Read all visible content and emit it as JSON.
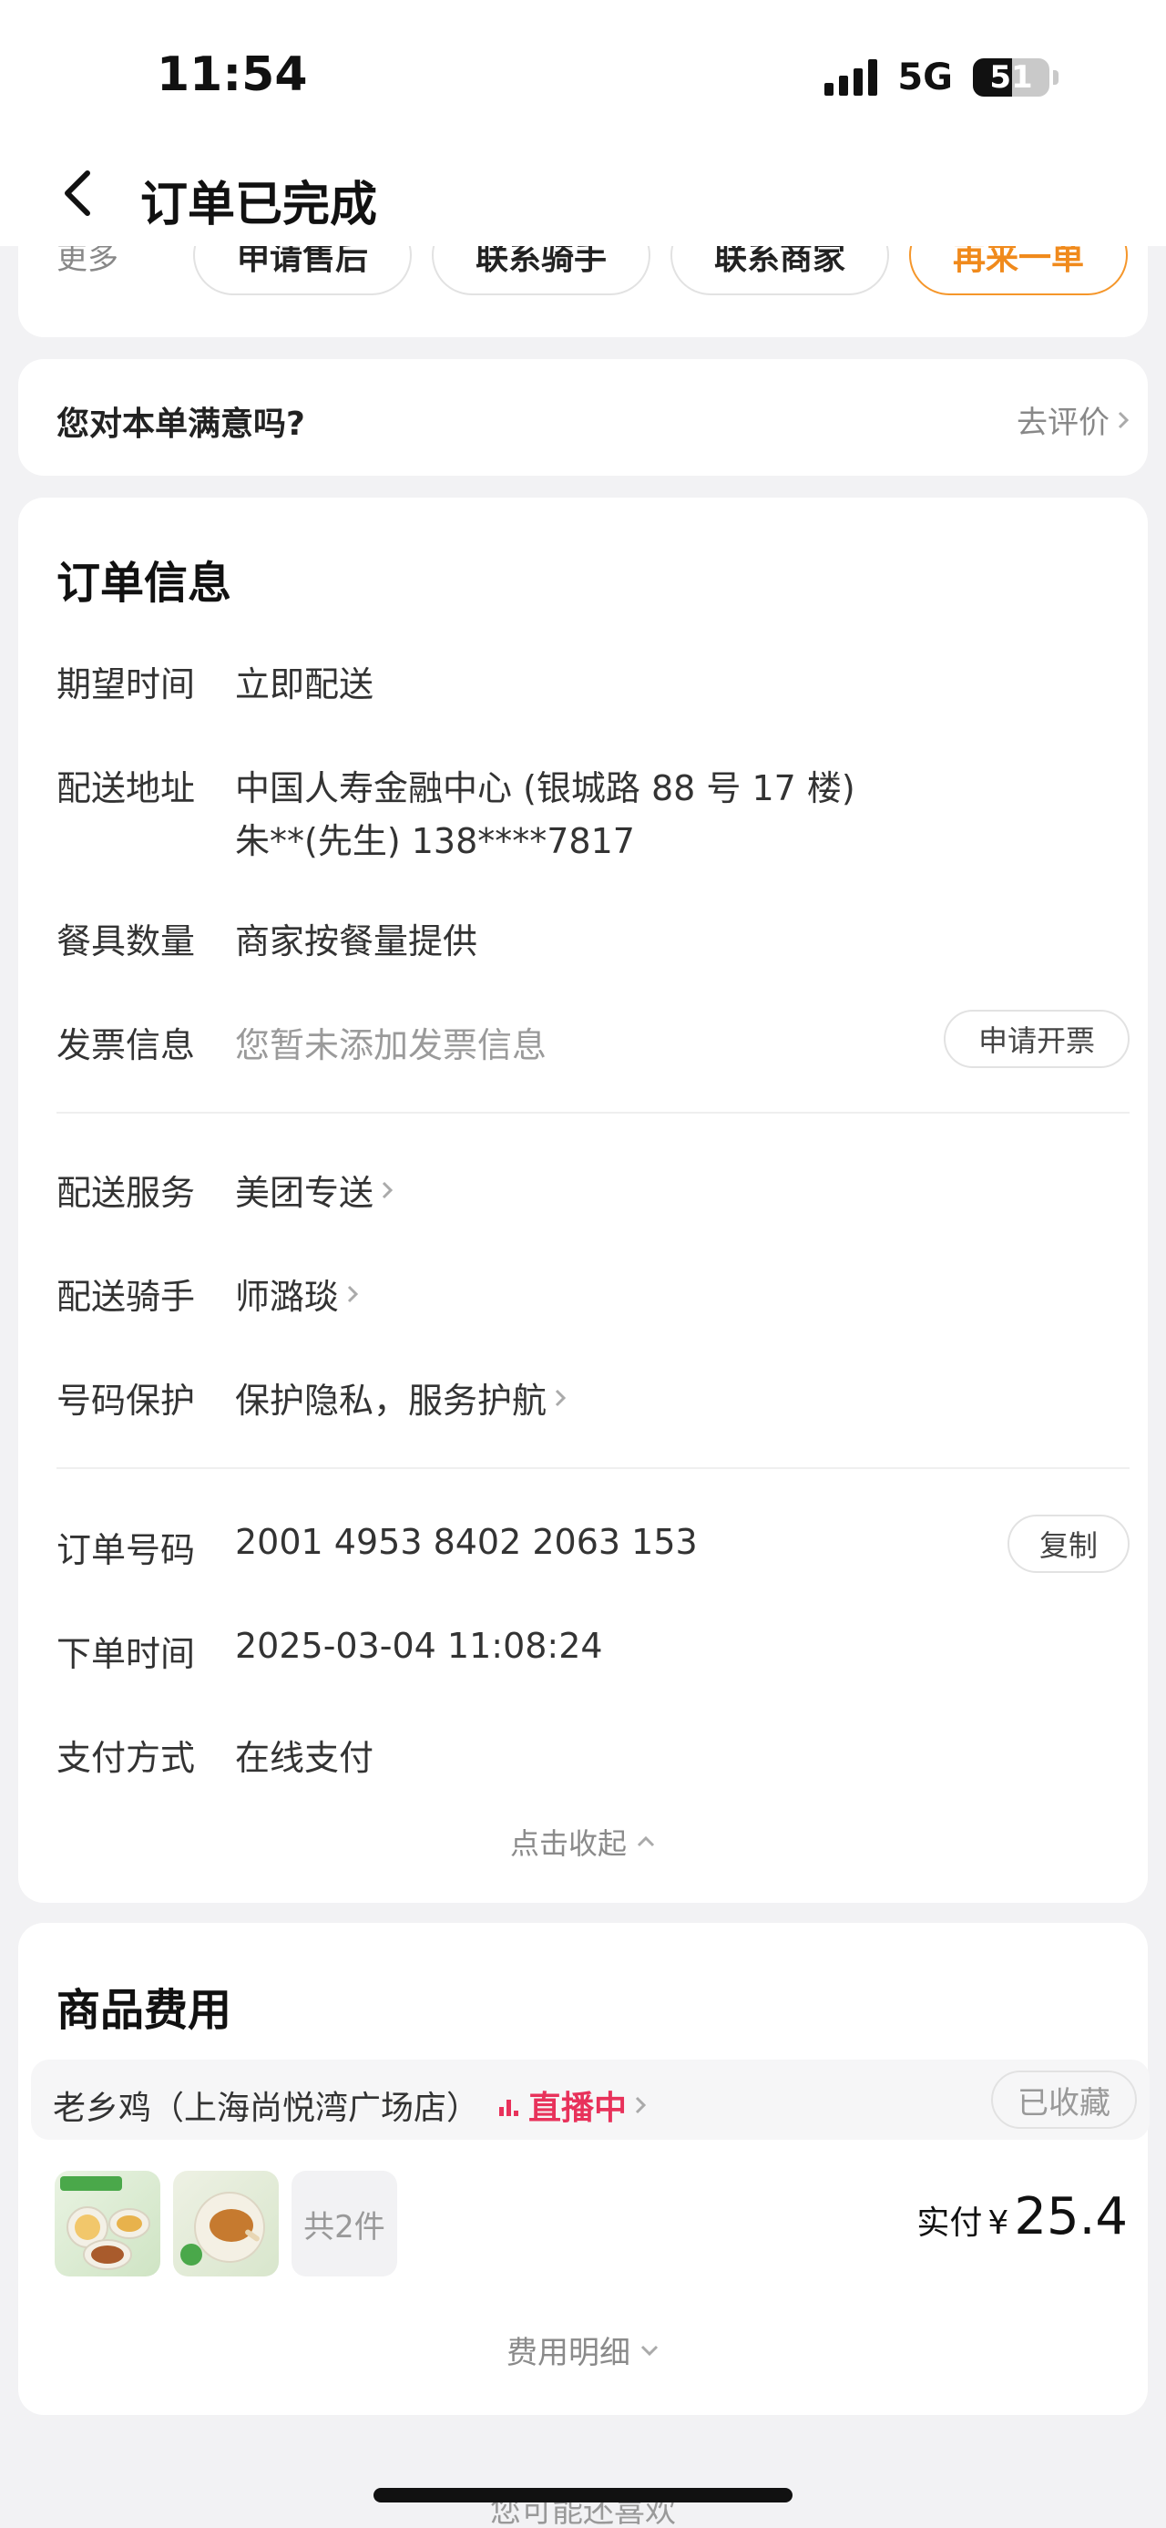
{
  "status_bar": {
    "time": "11:54",
    "network": "5G",
    "battery": "51"
  },
  "nav": {
    "title": "订单已完成"
  },
  "actions": {
    "more": "更多",
    "buttons": [
      "申请售后",
      "联系骑手",
      "联系商家",
      "再来一单"
    ]
  },
  "rating": {
    "question": "您对本单满意吗?",
    "link": "去评价"
  },
  "order_info": {
    "title": "订单信息",
    "expect_time": {
      "label": "期望时间",
      "value": "立即配送"
    },
    "address": {
      "label": "配送地址",
      "line1": "中国人寿金融中心 (银城路 88 号 17 楼)",
      "line2": "朱**(先生) 138****7817"
    },
    "tableware": {
      "label": "餐具数量",
      "value": "商家按餐量提供"
    },
    "invoice": {
      "label": "发票信息",
      "value": "您暂未添加发票信息",
      "button": "申请开票"
    },
    "delivery_service": {
      "label": "配送服务",
      "value": "美团专送"
    },
    "rider": {
      "label": "配送骑手",
      "value": "师潞琰"
    },
    "number_protect": {
      "label": "号码保护",
      "value": "保护隐私，服务护航"
    },
    "order_no": {
      "label": "订单号码",
      "value": "2001 4953 8402 2063 153",
      "button": "复制"
    },
    "order_time": {
      "label": "下单时间",
      "value": "2025-03-04 11:08:24"
    },
    "pay_method": {
      "label": "支付方式",
      "value": "在线支付"
    },
    "collapse": "点击收起"
  },
  "goods": {
    "title": "商品费用",
    "store": "老乡鸡（上海尚悦湾广场店）",
    "live": "直播中",
    "fav": "已收藏",
    "count": "共2件",
    "pay_label": "实付",
    "currency": "¥",
    "amount": "25.4",
    "fee_detail": "费用明细"
  },
  "footer": {
    "maybe_like": "您可能还喜欢"
  },
  "colors": {
    "accent_orange": "#f08a1c",
    "live_red": "#e8325b"
  }
}
